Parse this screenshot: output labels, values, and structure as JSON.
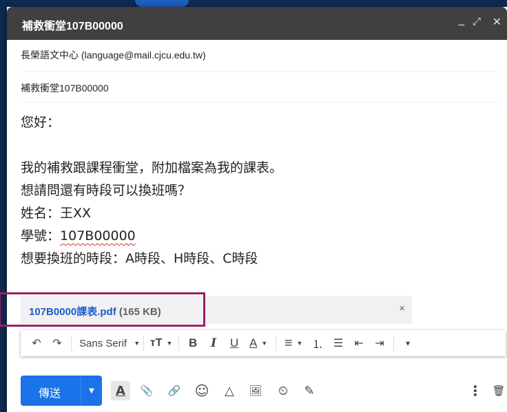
{
  "window": {
    "title": "補救衝堂107B00000",
    "minimize_glyph": "_",
    "maximize_glyph": "⤢",
    "close_glyph": "✕"
  },
  "recipients": "長榮語文中心 (language@mail.cjcu.edu.tw)",
  "subject": "補救衝堂107B00000",
  "body": {
    "greeting": "您好：",
    "line1": "我的補救跟課程衝堂，附加檔案為我的課表。",
    "line2": "想請問還有時段可以換班嗎？",
    "name_line": "姓名：王XX",
    "id_label": "學號：",
    "id_value": "107B00000",
    "slots_line": "想要換班的時段：A時段、H時段、C時段"
  },
  "attachment": {
    "name": "107B0000課表.pdf",
    "size": "(165 KB)",
    "close_glyph": "×"
  },
  "toolbar": {
    "undo": "↶",
    "redo": "↷",
    "font": "Sans Serif",
    "size": "тT",
    "bold": "B",
    "italic": "I",
    "underline": "U",
    "text_color": "A",
    "align": "≡",
    "numbered_list": "⒈",
    "bulleted_list": "☰",
    "indent_less": "⇤",
    "indent_more": "⇥",
    "more": "▾"
  },
  "bottom": {
    "send_label": "傳送",
    "send_options": "▼",
    "formatting": "A",
    "attach": "📎",
    "link": "🔗",
    "emoji": "☺",
    "drive": "△",
    "photo": "🖼",
    "confidential": "⏲",
    "signature": "✎",
    "more": "⋮",
    "discard": "🗑"
  },
  "colors": {
    "send": "#1a73e8",
    "titlebar": "#404040",
    "attachment_name": "#1a5ccc",
    "highlight": "#9c1e66"
  }
}
